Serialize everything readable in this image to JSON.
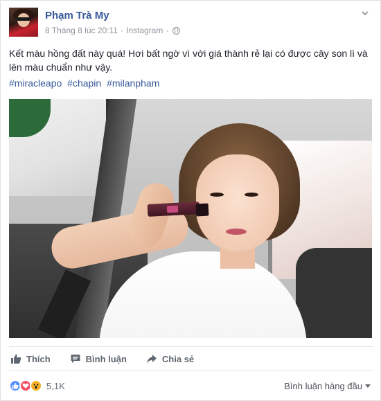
{
  "post": {
    "author": "Phạm Trà My",
    "date": "8 Tháng 8 lúc 20:11",
    "separator": "·",
    "source": "Instagram",
    "separator2": "·",
    "text": "Kết màu hồng đất này quá! Hơi bất ngờ vì với giá thành rẻ lại có được cây son lì và lên màu chuẩn như vậy.",
    "hashtags": [
      "#miracleapo",
      "#chapin",
      "#milanpham"
    ]
  },
  "actions": {
    "like_label": "Thích",
    "comment_label": "Bình luận",
    "share_label": "Chia sẻ"
  },
  "reactions": {
    "icons": [
      "like-icon",
      "love-icon",
      "wow-icon"
    ],
    "count": "5,1K",
    "sort_label": "Bình luận hàng đầu"
  },
  "colors": {
    "link": "#365899",
    "muted": "#90949c",
    "action": "#606770",
    "like": "#5890ff",
    "love": "#f25268",
    "wow": "#f7b125"
  }
}
